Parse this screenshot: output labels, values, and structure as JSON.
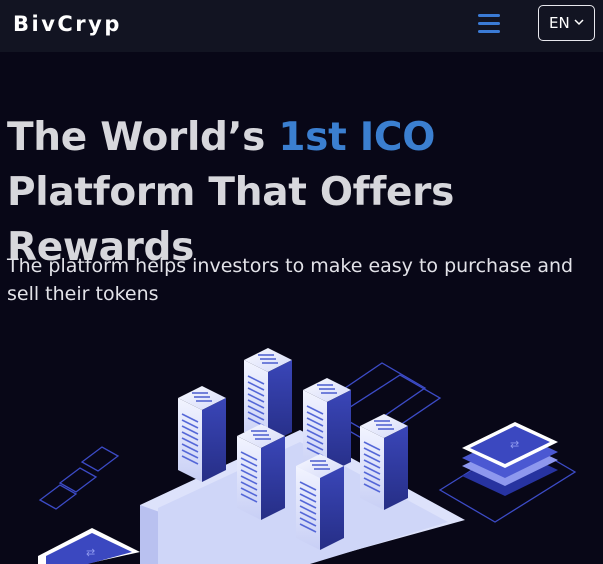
{
  "header": {
    "logo_text": "BivCryp",
    "menu_icon": "hamburger-menu-icon",
    "language_label": "EN",
    "language_icon": "chevron-down-icon"
  },
  "hero": {
    "title_part1": "The World’s ",
    "title_highlight": "1st ICO",
    "title_part2": " Platform That Offers Rewards",
    "subtitle": "The platform helps investors to make easy to purchase and sell their tokens"
  },
  "colors": {
    "background": "#080717",
    "header": "#121422",
    "accent": "#3b7fd0",
    "heading_text": "#d7d7dc"
  },
  "illustration": {
    "icon": "isometric-server-racks-illustration"
  }
}
